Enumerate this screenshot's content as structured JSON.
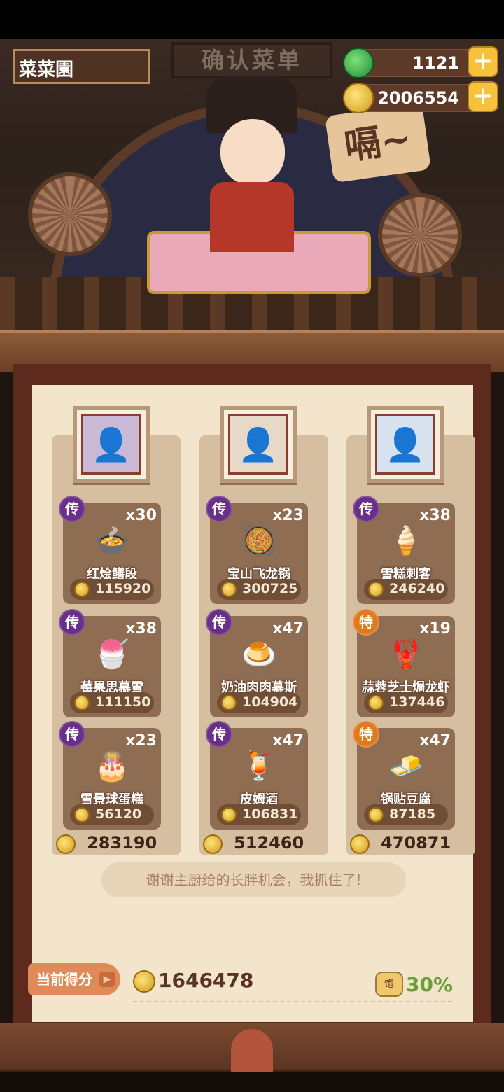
{
  "header": {
    "player_name": "菜菜園",
    "sign_text": "确认菜单",
    "jade": {
      "value": "1121",
      "icon": "jade-icon"
    },
    "coins": {
      "value": "2006554",
      "icon": "coin-icon"
    },
    "plus_label": "+"
  },
  "scene": {
    "speech_bubble": "嗝~"
  },
  "columns": [
    {
      "portrait_icon": "chef-portrait-1",
      "dishes": [
        {
          "badge": "传",
          "badge_type": "legend",
          "qty": "x30",
          "name": "红烩鳝段",
          "price": "115920",
          "food": "🍲"
        },
        {
          "badge": "传",
          "badge_type": "legend",
          "qty": "x38",
          "name": "莓果思慕雪",
          "price": "111150",
          "food": "🍧"
        },
        {
          "badge": "传",
          "badge_type": "legend",
          "qty": "x23",
          "name": "雪景球蛋糕",
          "price": "56120",
          "food": "🎂"
        }
      ],
      "total": "283190"
    },
    {
      "portrait_icon": "chef-portrait-2",
      "dishes": [
        {
          "badge": "传",
          "badge_type": "legend",
          "qty": "x23",
          "name": "宝山飞龙锅",
          "price": "300725",
          "food": "🥘"
        },
        {
          "badge": "传",
          "badge_type": "legend",
          "qty": "x47",
          "name": "奶油肉肉慕斯",
          "price": "104904",
          "food": "🍮"
        },
        {
          "badge": "传",
          "badge_type": "legend",
          "qty": "x47",
          "name": "皮姆酒",
          "price": "106831",
          "food": "🍹"
        }
      ],
      "total": "512460"
    },
    {
      "portrait_icon": "chef-portrait-3",
      "dishes": [
        {
          "badge": "传",
          "badge_type": "legend",
          "qty": "x38",
          "name": "雪糕刺客",
          "price": "246240",
          "food": "🍦"
        },
        {
          "badge": "特",
          "badge_type": "special",
          "qty": "x19",
          "name": "蒜蓉芝士焗龙虾",
          "price": "137446",
          "food": "🦞"
        },
        {
          "badge": "特",
          "badge_type": "special",
          "qty": "x47",
          "name": "锅贴豆腐",
          "price": "87185",
          "food": "🧈"
        }
      ],
      "total": "470871"
    }
  ],
  "message": "谢谢主厨给的长胖机会，我抓住了!",
  "score": {
    "label": "当前得分",
    "arrow": "▶",
    "value": "1646478",
    "bonus_icon_text": "饱",
    "bonus": "30%"
  },
  "colors": {
    "legend_badge": "#6a2f88",
    "special_badge": "#e17a1d",
    "paper": "#f2e5cb",
    "bonus_green": "#6aa03a"
  }
}
